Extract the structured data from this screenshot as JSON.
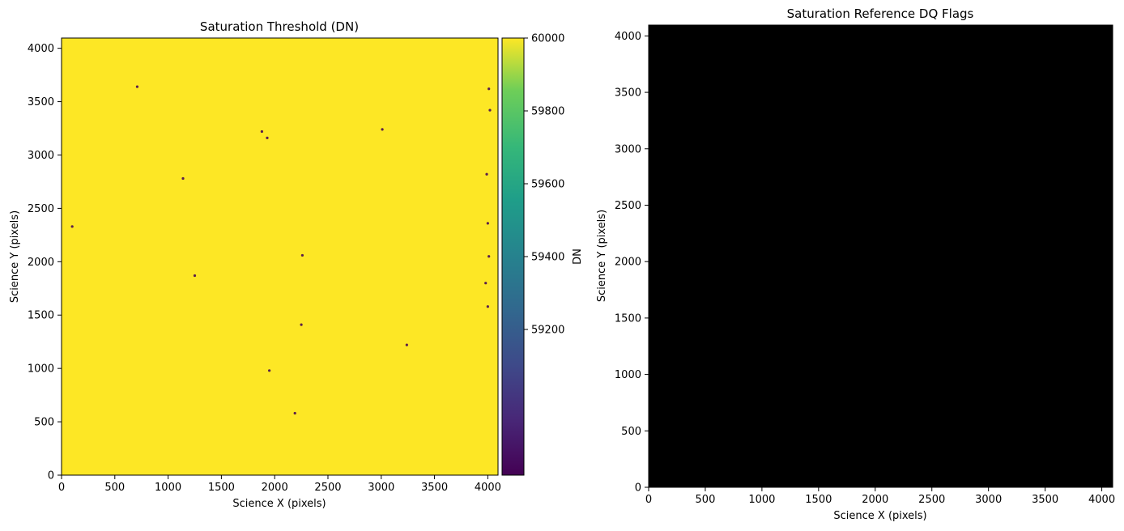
{
  "colors": {
    "threshold_fill": "#fde725",
    "dq_fill": "#000000",
    "colormap": "viridis",
    "speck": "#5a1f4b"
  },
  "chart_data": [
    {
      "type": "heatmap",
      "title": "Saturation Threshold (DN)",
      "xlabel": "Science X (pixels)",
      "ylabel": "Science Y (pixels)",
      "xlim": [
        0,
        4096
      ],
      "ylim": [
        0,
        4096
      ],
      "xticks": [
        0,
        500,
        1000,
        1500,
        2000,
        2500,
        3000,
        3500,
        4000
      ],
      "yticks": [
        0,
        500,
        1000,
        1500,
        2000,
        2500,
        3000,
        3500,
        4000
      ],
      "dominant_value": 60000,
      "colorbar": {
        "label": "DN",
        "colormap": "viridis",
        "range": [
          58800,
          60000
        ],
        "ticks": [
          59200,
          59400,
          59600,
          59800,
          60000
        ]
      },
      "features": [
        {
          "x": 100,
          "y": 2330
        },
        {
          "x": 710,
          "y": 3640
        },
        {
          "x": 1140,
          "y": 2780
        },
        {
          "x": 1250,
          "y": 1870
        },
        {
          "x": 1950,
          "y": 980
        },
        {
          "x": 2190,
          "y": 580
        },
        {
          "x": 2260,
          "y": 2060
        },
        {
          "x": 1880,
          "y": 3220
        },
        {
          "x": 3010,
          "y": 3240
        },
        {
          "x": 3240,
          "y": 1220
        },
        {
          "x": 2250,
          "y": 1410
        },
        {
          "x": 1930,
          "y": 3160
        },
        {
          "x": 4000,
          "y": 2360
        },
        {
          "x": 4010,
          "y": 2050
        },
        {
          "x": 3980,
          "y": 1800
        },
        {
          "x": 4000,
          "y": 1580
        },
        {
          "x": 3990,
          "y": 2820
        },
        {
          "x": 4020,
          "y": 3420
        },
        {
          "x": 4010,
          "y": 3620
        }
      ]
    },
    {
      "type": "heatmap",
      "title": "Saturation Reference DQ Flags",
      "xlabel": "Science X (pixels)",
      "ylabel": "Science Y (pixels)",
      "xlim": [
        0,
        4096
      ],
      "ylim": [
        0,
        4096
      ],
      "xticks": [
        0,
        500,
        1000,
        1500,
        2000,
        2500,
        3000,
        3500,
        4000
      ],
      "yticks": [
        0,
        500,
        1000,
        1500,
        2000,
        2500,
        3000,
        3500,
        4000
      ],
      "dominant_value": 0
    }
  ]
}
